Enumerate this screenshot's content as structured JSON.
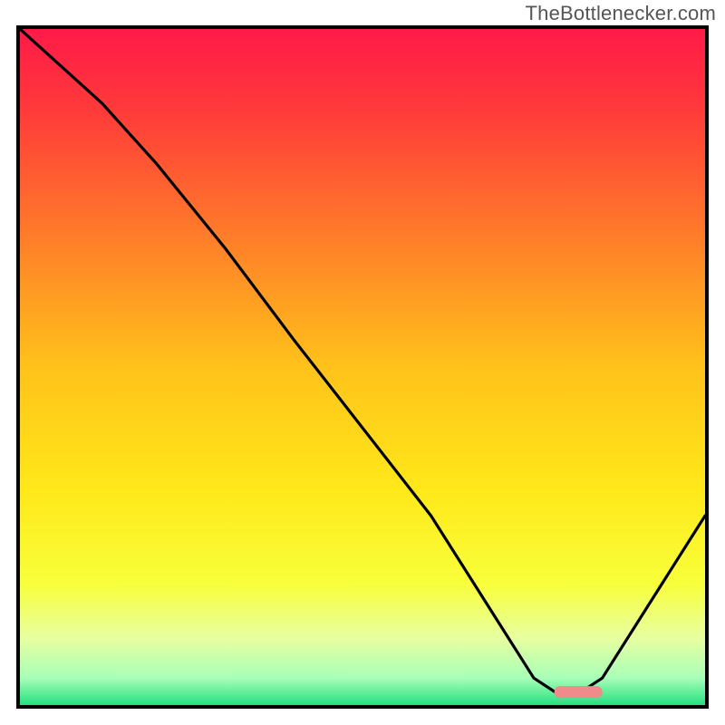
{
  "header": {
    "watermark": "TheBottlenecker.com"
  },
  "chart_data": {
    "type": "line",
    "title": "",
    "xlabel": "",
    "ylabel": "",
    "xlim": [
      0,
      100
    ],
    "ylim": [
      0,
      100
    ],
    "grid": false,
    "legend": false,
    "background_gradient": {
      "stops": [
        {
          "offset": 0.0,
          "color": "#ff1a49"
        },
        {
          "offset": 0.12,
          "color": "#ff3a3a"
        },
        {
          "offset": 0.3,
          "color": "#ff7a2a"
        },
        {
          "offset": 0.5,
          "color": "#ffc21a"
        },
        {
          "offset": 0.68,
          "color": "#ffe81a"
        },
        {
          "offset": 0.82,
          "color": "#f8ff3a"
        },
        {
          "offset": 0.9,
          "color": "#e8ffa0"
        },
        {
          "offset": 0.96,
          "color": "#a8ffb8"
        },
        {
          "offset": 1.0,
          "color": "#24e07f"
        }
      ]
    },
    "series": [
      {
        "name": "bottleneck-curve",
        "color": "#000000",
        "x": [
          0,
          12,
          20,
          30,
          40,
          50,
          60,
          70,
          75,
          78,
          82,
          85,
          90,
          95,
          100
        ],
        "values": [
          100,
          89,
          80,
          67.5,
          54,
          41,
          28,
          12,
          4,
          2,
          2,
          4,
          12,
          20,
          28
        ]
      }
    ],
    "markers": [
      {
        "name": "optimal-marker",
        "shape": "pill",
        "color": "#ef8b8b",
        "x_range": [
          78,
          85
        ],
        "y": 2
      }
    ]
  }
}
